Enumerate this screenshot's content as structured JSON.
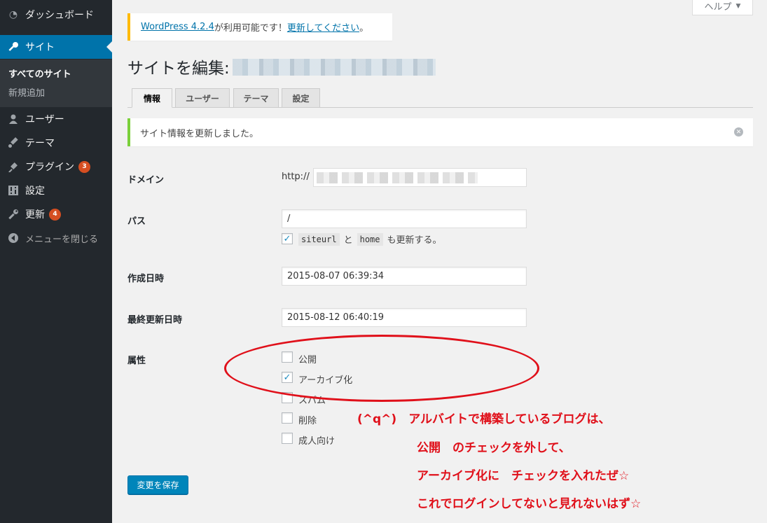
{
  "sidebar": {
    "items": [
      {
        "label": "ダッシュボード",
        "icon": "dashboard-icon"
      },
      {
        "label": "サイト",
        "icon": "key-icon"
      },
      {
        "label": "ユーザー",
        "icon": "user-icon"
      },
      {
        "label": "テーマ",
        "icon": "paintbrush-icon"
      },
      {
        "label": "プラグイン",
        "icon": "plugin-icon",
        "badge": "3"
      },
      {
        "label": "設定",
        "icon": "settings-icon"
      },
      {
        "label": "更新",
        "icon": "wrench-icon",
        "badge": "4"
      },
      {
        "label": "メニューを閉じる",
        "icon": "collapse-icon"
      }
    ],
    "submenu": {
      "all_sites": "すべてのサイト",
      "add_new": "新規追加"
    }
  },
  "help": {
    "label": "ヘルプ"
  },
  "update_nag": {
    "link1": "WordPress 4.2.4",
    "text": "が利用可能です！",
    "link2": "更新してください",
    "end": "。"
  },
  "page": {
    "title": "サイトを編集:"
  },
  "tabs": [
    "情報",
    "ユーザー",
    "テーマ",
    "設定"
  ],
  "notice": {
    "message": "サイト情報を更新しました。"
  },
  "form": {
    "domain_label": "ドメイン",
    "domain_prefix": "http://",
    "path_label": "パス",
    "path_value": "/",
    "path_option": {
      "code1": "siteurl",
      "mid": "と",
      "code2": "home",
      "end": "も更新する。",
      "checked": true
    },
    "created_label": "作成日時",
    "created_value": "2015-08-07 06:39:34",
    "updated_label": "最終更新日時",
    "updated_value": "2015-08-12 06:40:19",
    "attributes_label": "属性",
    "attributes": [
      {
        "label": "公開",
        "checked": false
      },
      {
        "label": "アーカイブ化",
        "checked": true
      },
      {
        "label": "スパム",
        "checked": false
      },
      {
        "label": "削除",
        "checked": false
      },
      {
        "label": "成人向け",
        "checked": false
      }
    ],
    "save_label": "変更を保存"
  },
  "annotation": {
    "line1": "(^q^)　アルバイトで構築しているブログは、",
    "line2": "公開　のチェックを外して、",
    "line3": "アーカイブ化に　チェックを入れたぜ☆",
    "line4": "これでログインしてないと見れないはず☆"
  },
  "colors": {
    "sidebar_bg": "#23282d",
    "accent": "#0073aa",
    "badge": "#d54e21",
    "annotation": "#e0101a"
  }
}
